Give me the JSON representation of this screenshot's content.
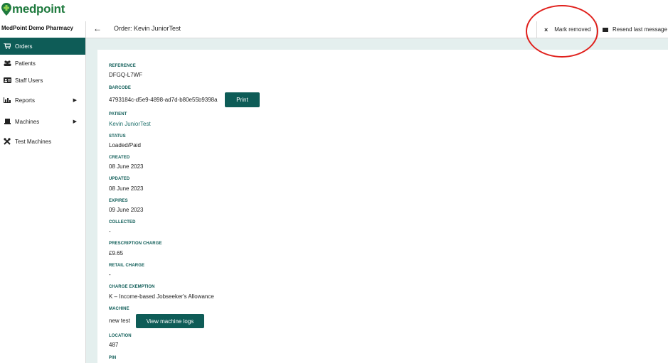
{
  "app": {
    "logo_text": "medpoint"
  },
  "header": {
    "pharmacy_name": "MedPoint Demo Pharmacy",
    "back_icon": "back-arrow-icon",
    "order_title": "Order: Kevin JuniorTest",
    "mark_removed_label": "Mark removed",
    "resend_label": "Resend last message"
  },
  "sidebar": {
    "items": [
      {
        "label": "Orders",
        "icon": "cart-icon",
        "active": true
      },
      {
        "label": "Patients",
        "icon": "people-icon"
      },
      {
        "label": "Staff Users",
        "icon": "id-card-icon"
      },
      {
        "label": "Reports",
        "icon": "chart-icon",
        "has_submenu": true
      },
      {
        "label": "Machines",
        "icon": "machine-icon",
        "has_submenu": true
      },
      {
        "label": "Test Machines",
        "icon": "tools-icon"
      }
    ]
  },
  "order": {
    "reference_label": "REFERENCE",
    "reference": "DFGQ-L7WF",
    "barcode_label": "BARCODE",
    "barcode": "4793184c-d5e9-4898-ad7d-b80e55b9398a",
    "print_label": "Print",
    "patient_label": "PATIENT",
    "patient": "Kevin JuniorTest",
    "status_label": "STATUS",
    "status": "Loaded/Paid",
    "created_label": "CREATED",
    "created": "08 June 2023",
    "updated_label": "UPDATED",
    "updated": "08 June 2023",
    "expires_label": "EXPIRES",
    "expires": "09 June 2023",
    "collected_label": "COLLECTED",
    "collected": "-",
    "prescription_charge_label": "PRESCRIPTION CHARGE",
    "prescription_charge": "£9.65",
    "retail_charge_label": "RETAIL CHARGE",
    "retail_charge": "-",
    "charge_exemption_label": "CHARGE EXEMPTION",
    "charge_exemption": "K – Income-based Jobseeker's Allowance",
    "machine_label": "MACHINE",
    "machine": "new test",
    "view_logs_label": "View machine logs",
    "location_label": "LOCATION",
    "location": "487",
    "pin_label": "PIN"
  },
  "colors": {
    "brand": "#0e5c57",
    "logo_green": "#1f7a3e",
    "annotation_red": "#e0201c",
    "content_bg": "#e4efee"
  }
}
